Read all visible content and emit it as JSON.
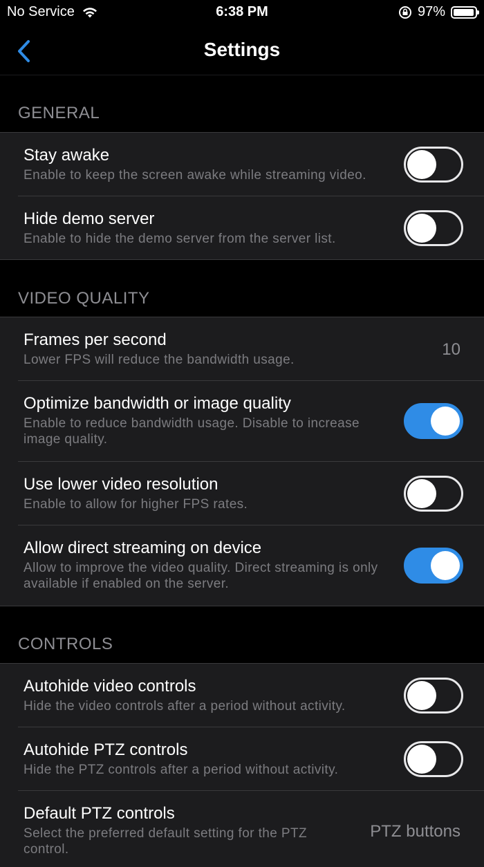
{
  "status_bar": {
    "carrier": "No Service",
    "time": "6:38 PM",
    "battery": "97%"
  },
  "nav": {
    "title": "Settings"
  },
  "sections": {
    "general": {
      "header": "GENERAL",
      "rows": [
        {
          "title": "Stay awake",
          "subtitle": "Enable to keep the screen awake while streaming video.",
          "toggle_on": false
        },
        {
          "title": "Hide demo server",
          "subtitle": "Enable to hide the demo server from the server list.",
          "toggle_on": false
        }
      ]
    },
    "video_quality": {
      "header": "VIDEO QUALITY",
      "rows": [
        {
          "title": "Frames per second",
          "subtitle": "Lower FPS will reduce the bandwidth usage.",
          "value": "10"
        },
        {
          "title": "Optimize bandwidth or image quality",
          "subtitle": "Enable to reduce bandwidth usage. Disable to increase image quality.",
          "toggle_on": true
        },
        {
          "title": "Use lower video resolution",
          "subtitle": "Enable to allow for higher FPS rates.",
          "toggle_on": false
        },
        {
          "title": "Allow direct streaming on device",
          "subtitle": "Allow to improve the video quality. Direct streaming is only available if enabled on the server.",
          "toggle_on": true
        }
      ]
    },
    "controls": {
      "header": "CONTROLS",
      "rows": [
        {
          "title": "Autohide video controls",
          "subtitle": "Hide the video controls after a period without activity.",
          "toggle_on": false
        },
        {
          "title": "Autohide PTZ controls",
          "subtitle": "Hide the PTZ controls after a period without activity.",
          "toggle_on": false
        },
        {
          "title": "Default PTZ controls",
          "subtitle": "Select the preferred default setting for the PTZ control.",
          "value": "PTZ buttons"
        }
      ]
    }
  },
  "colors": {
    "accent": "#2f8ce6",
    "background": "#000000",
    "cell": "#1c1c1e",
    "secondary_text": "#8e8e93"
  },
  "icons": {
    "back": "chevron-left-icon",
    "wifi": "wifi-icon",
    "rotation_lock": "rotation-lock-icon",
    "battery": "battery-icon"
  }
}
